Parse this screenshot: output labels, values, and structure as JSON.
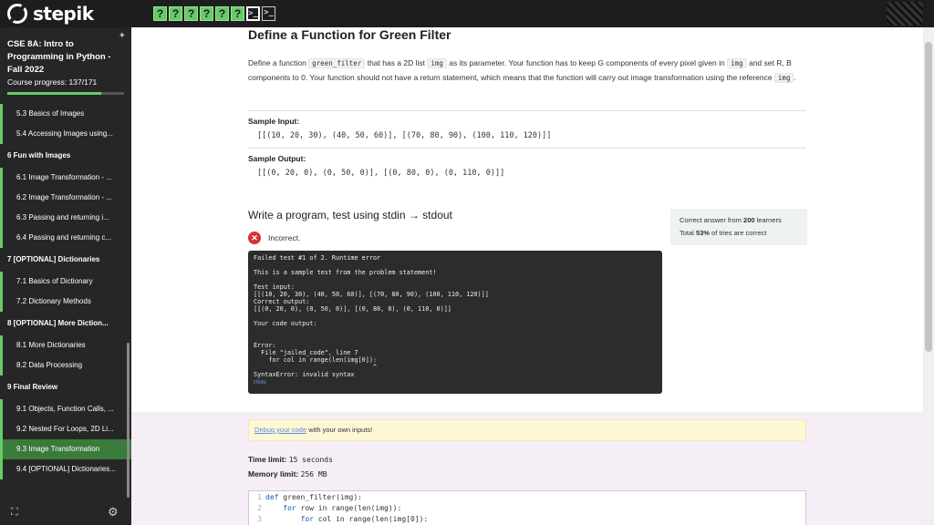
{
  "brand": "stepik",
  "steps": [
    "?",
    "?",
    "?",
    "?",
    "?",
    "?"
  ],
  "term_steps": [
    ">_",
    ">_"
  ],
  "sidebar": {
    "course_title": "CSE 8A: Intro to Programming in Python - Fall 2022",
    "progress_text": "Course progress: 137/171",
    "progress_fraction": 0.801,
    "items": [
      {
        "kind": "item",
        "label": "5.3 Basics of Images"
      },
      {
        "kind": "item",
        "label": "5.4 Accessing Images using..."
      },
      {
        "kind": "section",
        "label": "6 Fun with Images"
      },
      {
        "kind": "item",
        "label": "6.1 Image Transformation - ..."
      },
      {
        "kind": "item",
        "label": "6.2 Image Transformation - ..."
      },
      {
        "kind": "item",
        "label": "6.3 Passing and returning i..."
      },
      {
        "kind": "item",
        "label": "6.4 Passing and returning c..."
      },
      {
        "kind": "section",
        "label": "7 [OPTIONAL] Dictionaries"
      },
      {
        "kind": "item",
        "label": "7.1 Basics of Dictionary"
      },
      {
        "kind": "item",
        "label": "7.2 Dictionary Methods"
      },
      {
        "kind": "section",
        "label": "8 [OPTIONAL] More Diction..."
      },
      {
        "kind": "item",
        "label": "8.1 More Dictionaries"
      },
      {
        "kind": "item",
        "label": "8.2 Data Processing"
      },
      {
        "kind": "section",
        "label": "9 Final Review"
      },
      {
        "kind": "item",
        "label": "9.1 Objects, Function Calls, ..."
      },
      {
        "kind": "item",
        "label": "9.2 Nested For Loops, 2D Li..."
      },
      {
        "kind": "item",
        "label": "9.3 Image Transformation",
        "active": true
      },
      {
        "kind": "item",
        "label": "9.4 [OPTIONAL] Dictionaries..."
      }
    ]
  },
  "problem": {
    "title": "Define a Function for Green Filter",
    "desc_1": "Define a function ",
    "code_fn": "green_filter",
    "desc_2": " that has a 2D list ",
    "code_img": "img",
    "desc_3": " as its parameter. Your function has to keep G components of every pixel given in ",
    "code_img2": "img",
    "desc_4": " and set R, B components to 0. Your function should not have a return statement, which means that the function will carry out image transformation using the reference ",
    "code_img3": "img",
    "desc_5": ".",
    "sample_input_label": "Sample Input:",
    "sample_input": "[[(10, 20, 30), (40, 50, 60)], [(70, 80, 90), (100, 110, 120)]]",
    "sample_output_label": "Sample Output:",
    "sample_output": "[[(0, 20, 0), (0, 50, 0)], [(0, 80, 0), (0, 110, 0)]]"
  },
  "task": {
    "title": "Write a program, test using stdin → stdout",
    "stats_1a": "Correct answer from ",
    "stats_1b": "200",
    "stats_1c": " learners",
    "stats_2a": "Total ",
    "stats_2b": "53%",
    "stats_2c": " of tries are correct",
    "status": "Incorrect.",
    "console_text": "Failed test #1 of 2. Runtime error\n\nThis is a sample test from the problem statement!\n\nTest input:\n[[(10, 20, 30), (40, 50, 60)], [(70, 80, 90), (100, 110, 120)]]\nCorrect output:\n[[(0, 20, 0), (0, 50, 0)], [(0, 80, 0), (0, 110, 0)]]\n\nYour code output:\n\n\nError:\n  File \"jailed_code\", line 7\n    for col in range(len(img[0]):\n                                ^\nSyntaxError: invalid syntax",
    "hide_label": "Hide"
  },
  "footer": {
    "debug_link": "Debug your code",
    "debug_text": " with your own inputs!",
    "time_label": "Time limit:",
    "time_value": "15 seconds",
    "memory_label": "Memory limit:",
    "memory_value": "256 MB",
    "code_lines": [
      {
        "n": "1",
        "kw": "def",
        "rest": " green_filter(img):"
      },
      {
        "n": "2",
        "kw": "    for",
        "rest": " row in range(len(img)):"
      },
      {
        "n": "3",
        "kw": "        for",
        "rest": " col in range(len(img[0]):"
      }
    ]
  },
  "colors": {
    "accent": "#66cc66",
    "error": "#d63333",
    "topbar": "#1d1d1d",
    "sidebar": "#262626"
  }
}
